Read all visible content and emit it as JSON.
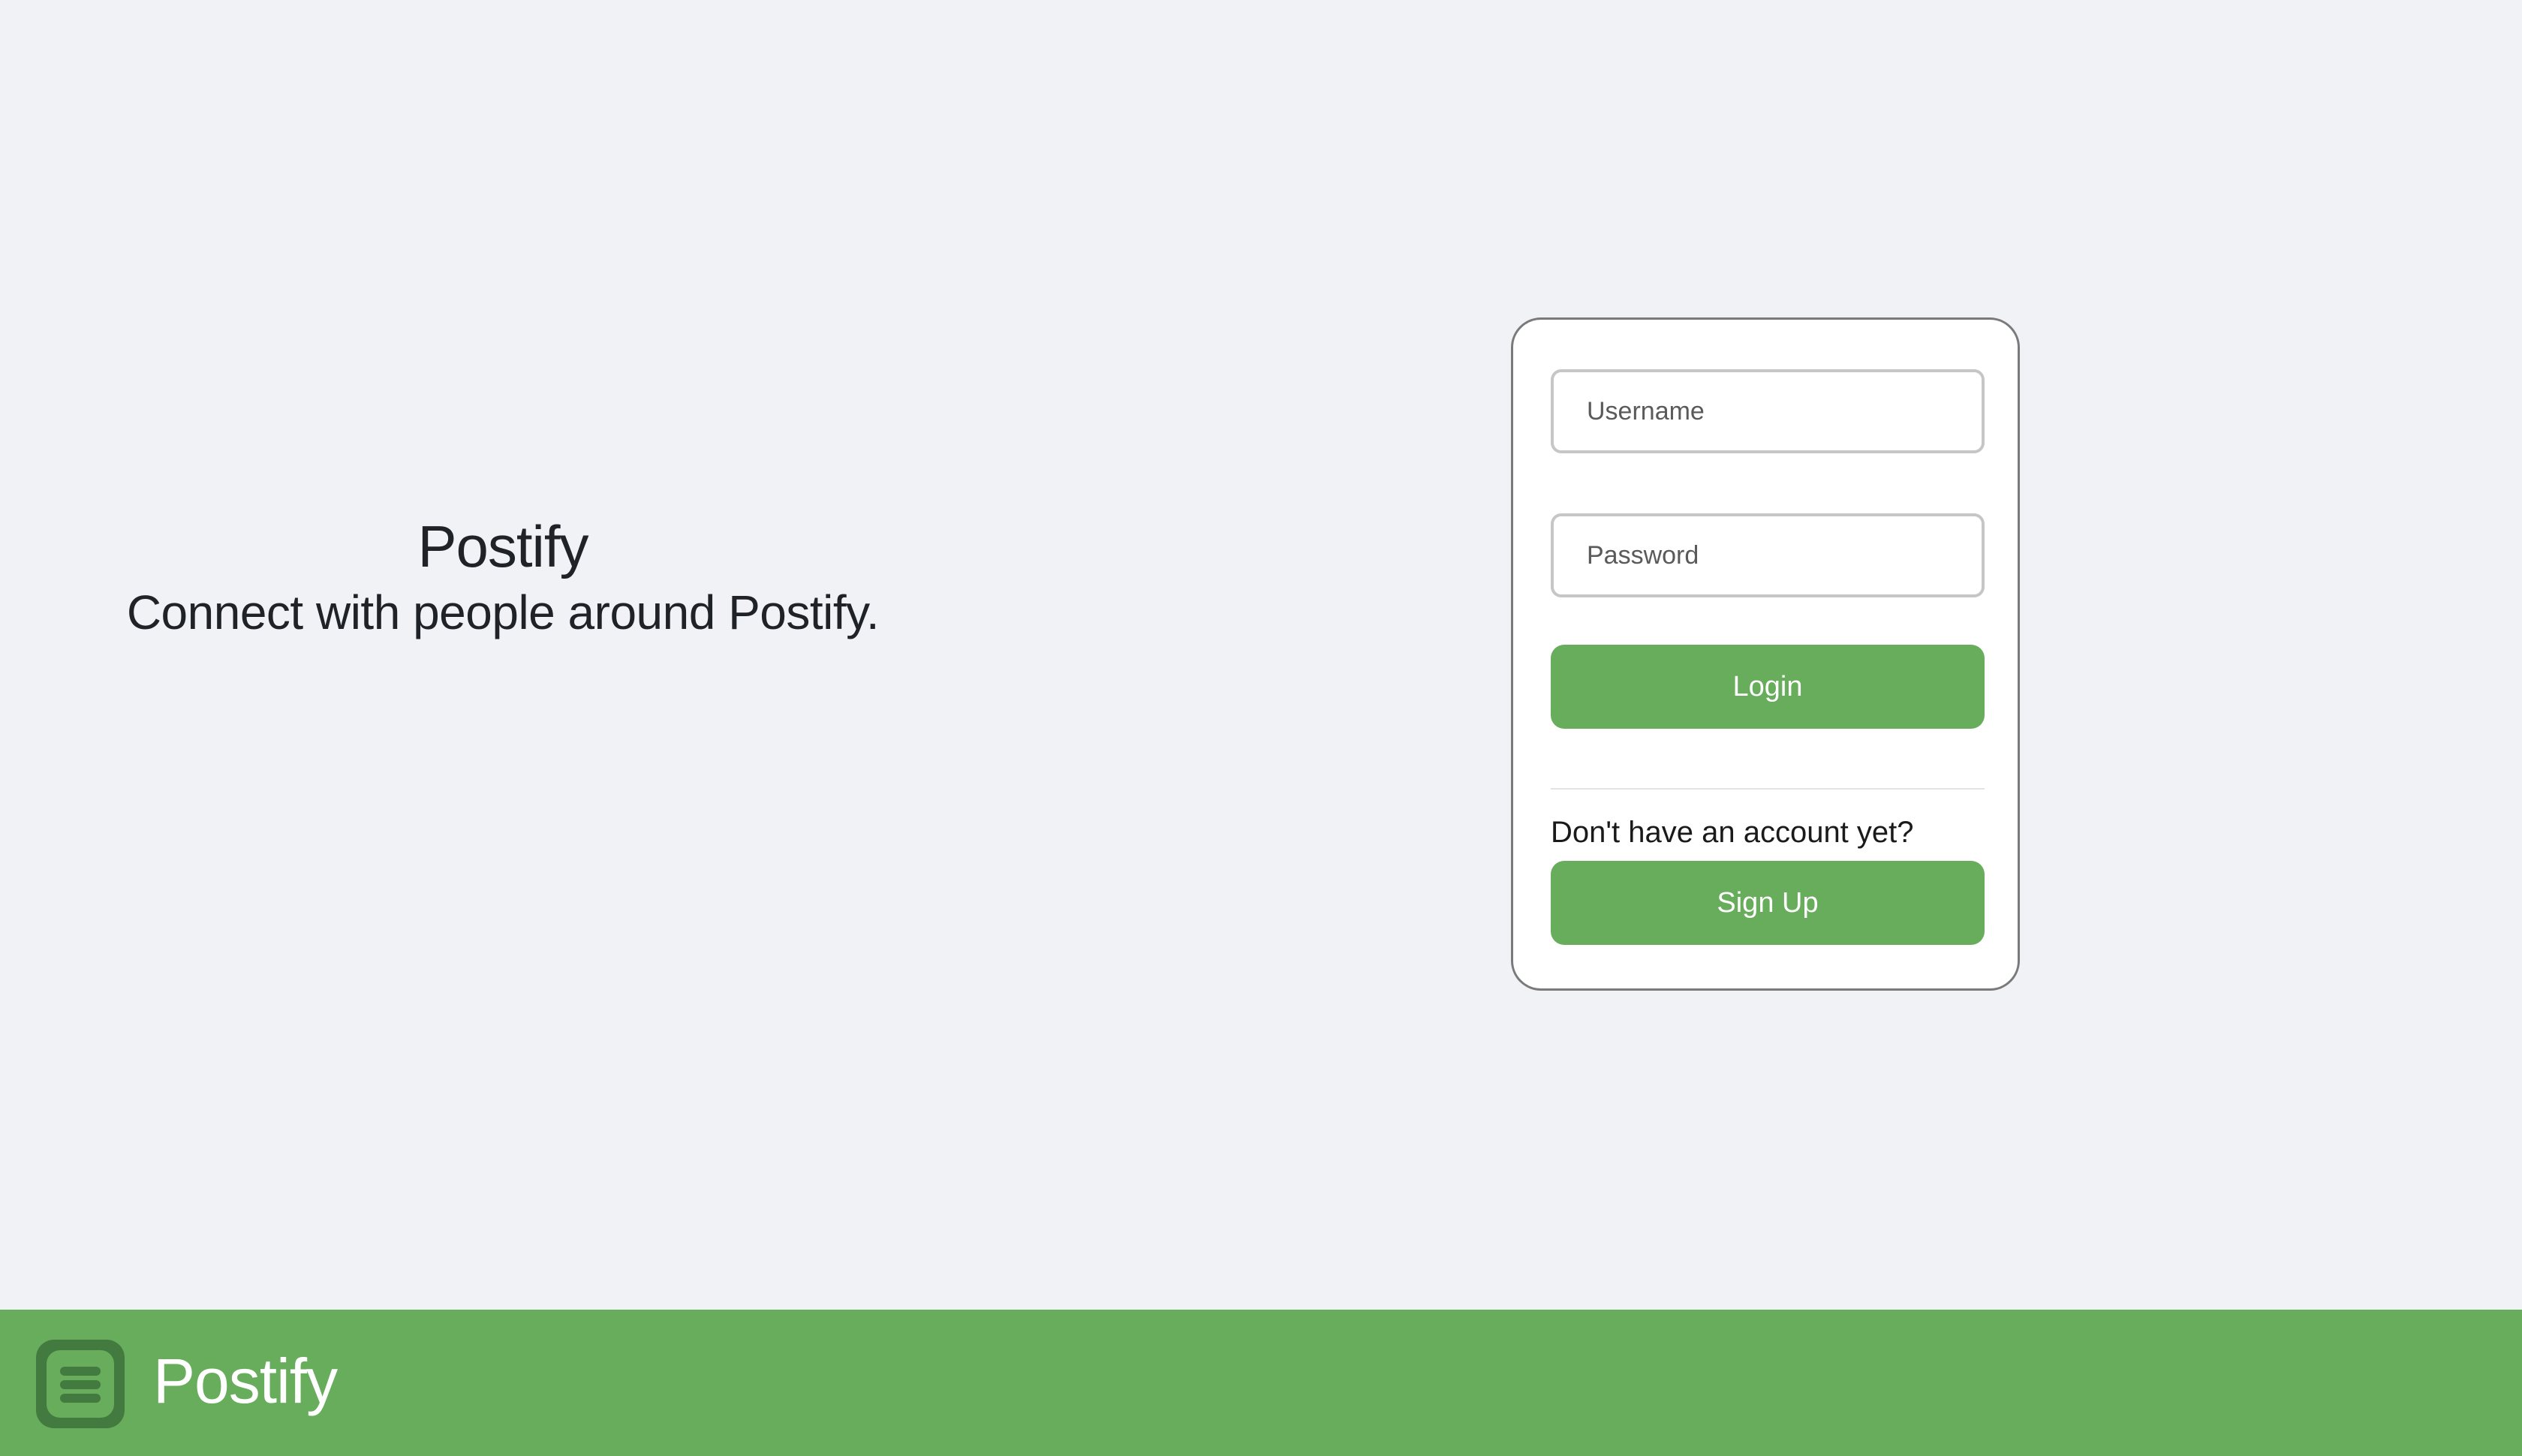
{
  "hero": {
    "title": "Postify",
    "tagline": "Connect with people around Postify."
  },
  "login_form": {
    "username": {
      "placeholder": "Username",
      "value": ""
    },
    "password": {
      "placeholder": "Password",
      "value": ""
    },
    "login_button": "Login",
    "signup_prompt": "Don't have an account yet?",
    "signup_button": "Sign Up"
  },
  "footer": {
    "logo_icon": "app-logo-icon",
    "brand": "Postify"
  },
  "colors": {
    "background": "#f0f2f5",
    "accent": "#67ad5b",
    "accent_dark": "#437a3f",
    "text": "#1f2328"
  }
}
